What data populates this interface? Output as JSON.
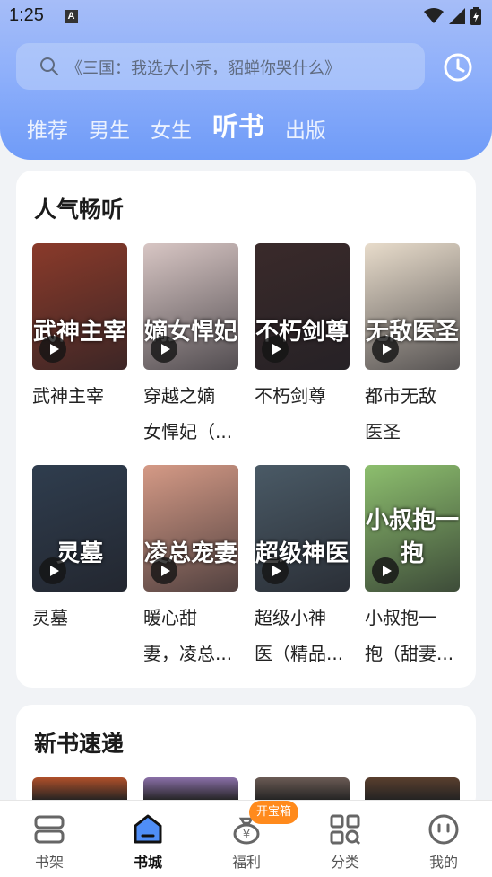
{
  "status_bar": {
    "time": "1:25",
    "notification_icon": "A"
  },
  "search": {
    "placeholder": "《三国：我选大小乔，貂蝉你哭什么》"
  },
  "tabs": [
    {
      "label": "推荐",
      "active": false
    },
    {
      "label": "男生",
      "active": false
    },
    {
      "label": "女生",
      "active": false
    },
    {
      "label": "听书",
      "active": true
    },
    {
      "label": "出版",
      "active": false
    }
  ],
  "popular": {
    "title": "人气畅听",
    "books": [
      {
        "title_line1": "武神主宰",
        "title_line2": "",
        "cover_text": "武神主宰",
        "color": "#8a3a2a"
      },
      {
        "title_line1": "穿越之嫡",
        "title_line2": "女悍妃（...",
        "cover_text": "嫡女悍妃",
        "color": "#d8c6c4"
      },
      {
        "title_line1": "不朽剑尊",
        "title_line2": "",
        "cover_text": "不朽剑尊",
        "color": "#3a2a2a"
      },
      {
        "title_line1": "都市无敌",
        "title_line2": "医圣",
        "cover_text": "无敌医圣",
        "color": "#e8dccb"
      },
      {
        "title_line1": "灵墓",
        "title_line2": "",
        "cover_text": "灵墓",
        "color": "#2f3d4e"
      },
      {
        "title_line1": "暖心甜",
        "title_line2": "妻，凌总...",
        "cover_text": "凌总宠妻",
        "color": "#d59a86"
      },
      {
        "title_line1": "超级小神",
        "title_line2": "医（精品...",
        "cover_text": "超级神医",
        "color": "#4a5a66"
      },
      {
        "title_line1": "小叔抱一",
        "title_line2": "抱（甜妻...",
        "cover_text": "小叔抱一抱",
        "color": "#8dbf6e"
      }
    ]
  },
  "new_books": {
    "title": "新书速递",
    "peek_colors": [
      "#b0502a",
      "#8a6fa8",
      "#6b5b55",
      "#5a3f2e"
    ]
  },
  "bottom_nav": {
    "items": [
      {
        "label": "书架",
        "icon": "bookshelf-icon"
      },
      {
        "label": "书城",
        "icon": "bookstore-icon",
        "active": true
      },
      {
        "label": "福利",
        "icon": "benefits-bag-icon"
      },
      {
        "label": "分类",
        "icon": "category-grid-icon"
      },
      {
        "label": "我的",
        "icon": "profile-face-icon"
      }
    ],
    "badge": "开宝箱"
  }
}
